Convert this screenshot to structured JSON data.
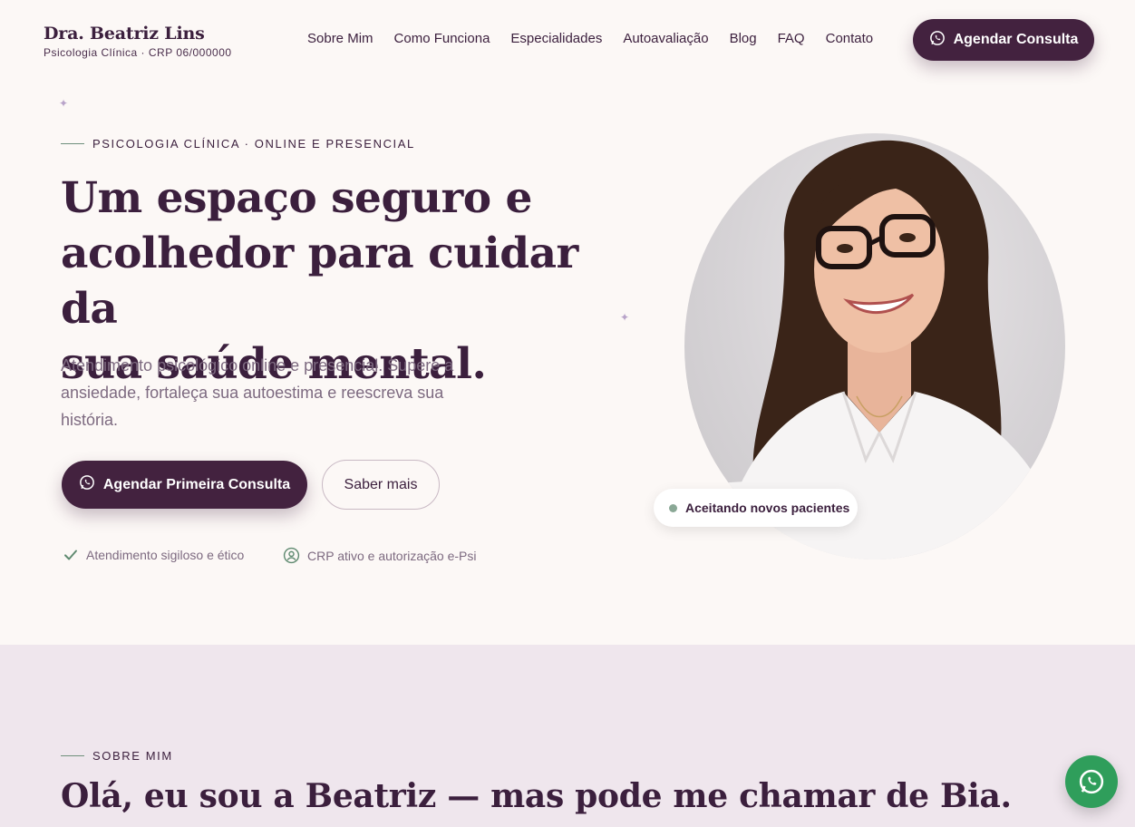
{
  "brand": {
    "name": "Dra. Beatriz Lins",
    "subtitle": "Psicologia Clínica · CRP 06/000000"
  },
  "nav": {
    "items": [
      "Sobre Mim",
      "Como Funciona",
      "Especialidades",
      "Autoavaliação",
      "Blog",
      "FAQ",
      "Contato"
    ],
    "cta_label": "Agendar Consulta"
  },
  "hero": {
    "eyebrow": "PSICOLOGIA CLÍNICA · ONLINE E PRESENCIAL",
    "title_lines": [
      "Um espaço seguro e",
      "acolhedor para cuidar da",
      "sua saúde mental."
    ],
    "description": "Atendimento psicológico online e presencial. Supere a ansiedade, fortaleça sua autoestima e reescreva sua história.",
    "primary_cta": "Agendar Primeira Consulta",
    "secondary_cta": "Saber mais",
    "trust_items": [
      "Atendimento sigiloso e ético",
      "CRP ativo e autorização e-Psi"
    ],
    "badge": "Aceitando novos pacientes"
  },
  "about": {
    "eyebrow": "SOBRE MIM",
    "title": "Olá, eu sou a Beatriz — mas pode me chamar de Bia."
  },
  "colors": {
    "primary": "#43223f",
    "background": "#fcf8f6",
    "section_bg": "#efe6ed",
    "accent_green": "#6f8f7c",
    "whatsapp": "#2f9e5b"
  },
  "icons": {
    "cta_icon": "whatsapp-icon",
    "trust_1": "check-icon",
    "trust_2": "user-shield-icon",
    "floating": "whatsapp-icon"
  }
}
